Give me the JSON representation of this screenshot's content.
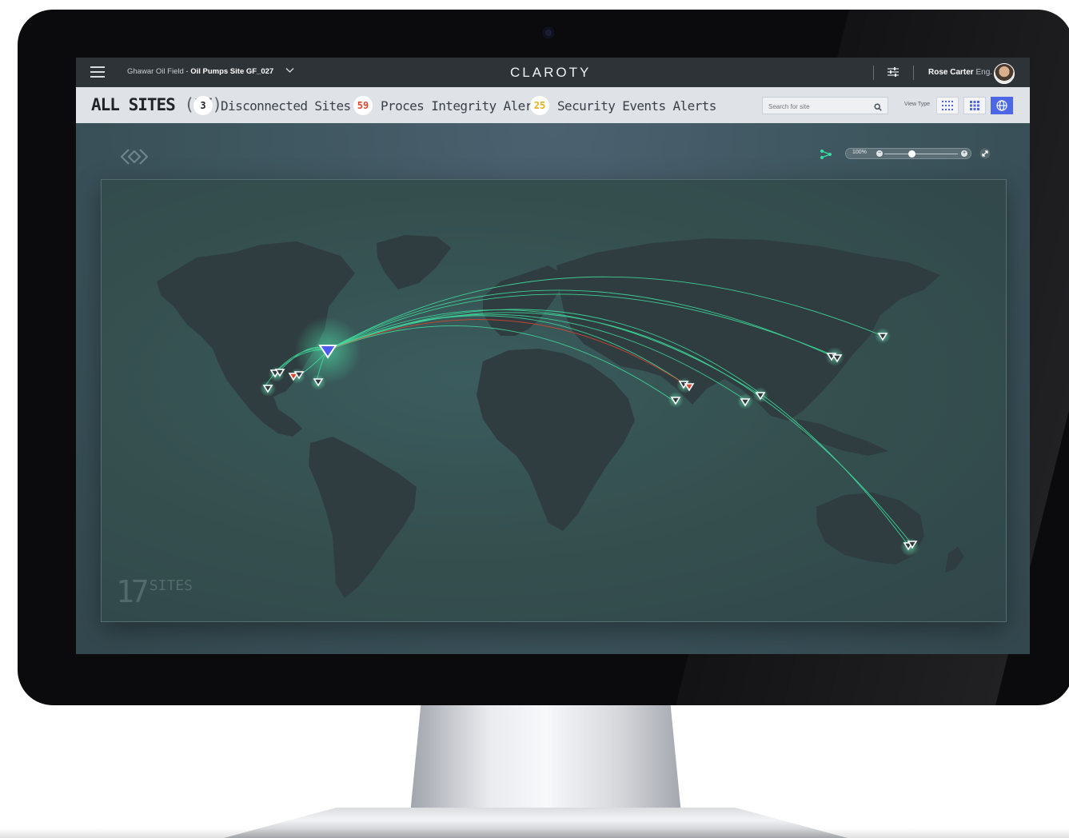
{
  "header": {
    "breadcrumb_prefix": "Ghawar Oil Field - ",
    "breadcrumb_site": "Oil Pumps Site GF_027",
    "logo": "CLAROTY",
    "user_name": "Rose Carter",
    "user_role": "Eng."
  },
  "summary": {
    "all_sites_label": "ALL SITES",
    "all_sites_count": "(17)",
    "stats": [
      {
        "value": "3",
        "label": "Disconnected Sites",
        "color": "#1f2429"
      },
      {
        "value": "59",
        "label": "Proces Integrity Alerts",
        "color": "#e2452d"
      },
      {
        "value": "25",
        "label": "Security Events Alerts",
        "color": "#e4b21a"
      }
    ],
    "search_placeholder": "Search for site",
    "view_type_label": "View Type",
    "view_types": [
      "list-view-icon",
      "grid-view-icon",
      "globe-view-icon"
    ],
    "active_view": "globe-view-icon"
  },
  "map": {
    "zoom_label": "100%",
    "zoom_level": 0.5,
    "sites_count": "17",
    "sites_label": "SITES",
    "accent_color": "#34e0a1",
    "alert_color": "#e2452d",
    "hub_color": "#4c5cf0"
  }
}
